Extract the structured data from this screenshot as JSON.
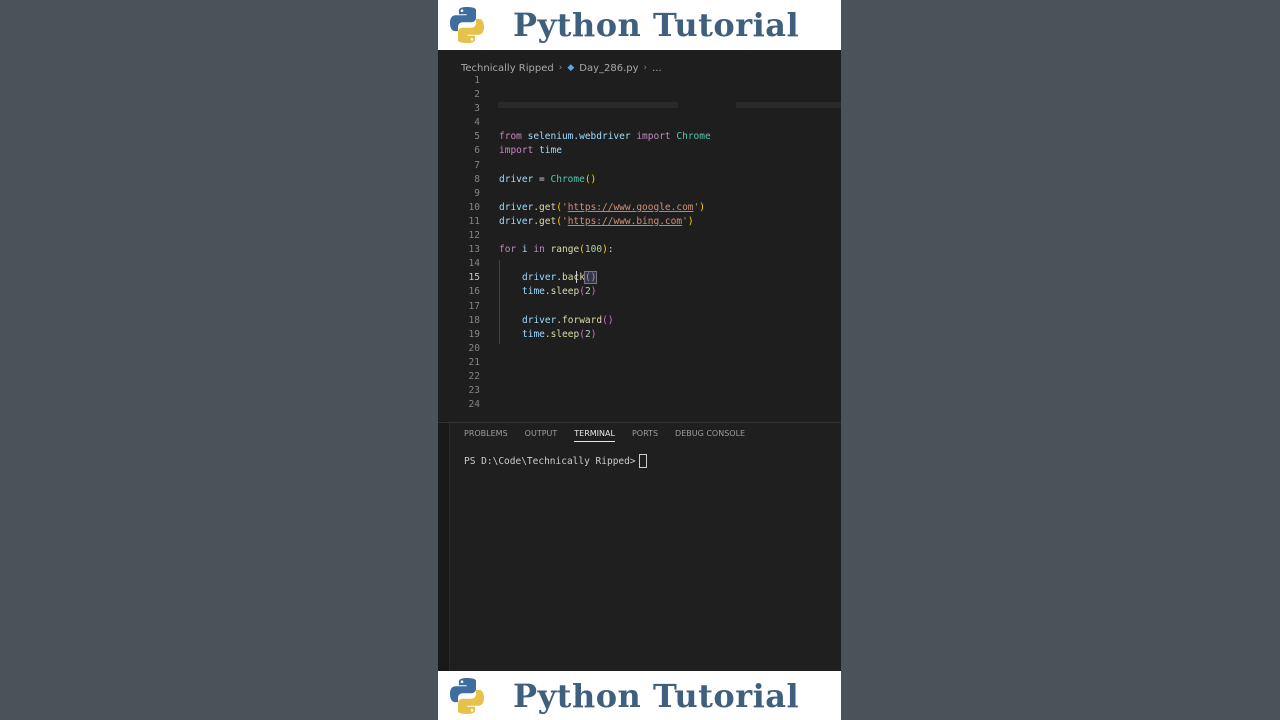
{
  "banner": {
    "title": "Python Tutorial"
  },
  "breadcrumb": {
    "folder": "Technically Ripped",
    "file": "Day_286.py",
    "more": "..."
  },
  "editor": {
    "line_numbers": [
      "1",
      "2",
      "3",
      "4",
      "5",
      "6",
      "7",
      "8",
      "9",
      "10",
      "11",
      "12",
      "13",
      "14",
      "15",
      "16",
      "17",
      "18",
      "19",
      "20",
      "21",
      "22",
      "23",
      "24"
    ],
    "active_line": "15",
    "code": {
      "l5": {
        "kw1": "from",
        "mod": "selenium.webdriver",
        "kw2": "import",
        "cls": "Chrome"
      },
      "l6": {
        "kw": "import",
        "mod": "time"
      },
      "l8": {
        "var": "driver",
        "op": " = ",
        "cls": "Chrome",
        "paren": "()"
      },
      "l10": {
        "obj": "driver",
        "fn": ".get",
        "open": "(",
        "q1": "'",
        "url": "https://www.google.com",
        "q2": "'",
        "close": ")"
      },
      "l11": {
        "obj": "driver",
        "fn": ".get",
        "open": "(",
        "q1": "'",
        "url": "https://www.bing.com",
        "q2": "'",
        "close": ")"
      },
      "l13": {
        "kw": "for",
        "var": "i",
        "kw2": "in",
        "fn": "range",
        "open": "(",
        "num": "100",
        "close": ")",
        "colon": ":"
      },
      "l15": {
        "obj": "driver",
        "fn": ".back",
        "paren": "()"
      },
      "l16": {
        "obj": "time",
        "fn": ".sleep",
        "open": "(",
        "num": "2",
        "close": ")"
      },
      "l18": {
        "obj": "driver",
        "fn": ".forward",
        "paren": "()"
      },
      "l19": {
        "obj": "time",
        "fn": ".sleep",
        "open": "(",
        "num": "2",
        "close": ")"
      }
    }
  },
  "panel": {
    "tabs": [
      "PROBLEMS",
      "OUTPUT",
      "TERMINAL",
      "PORTS",
      "DEBUG CONSOLE"
    ],
    "active_tab": "TERMINAL",
    "terminal_prompt": "PS D:\\Code\\Technically Ripped>"
  },
  "colors": {
    "background": "#4b5358",
    "editor_bg": "#1e1e1e",
    "banner_text": "#3f5f7f",
    "keyword": "#c586c0",
    "function": "#dcdcaa",
    "string": "#ce9178",
    "class": "#4ec9b0"
  },
  "icons": {
    "logo": "python-logo",
    "file": "python-file-icon"
  }
}
